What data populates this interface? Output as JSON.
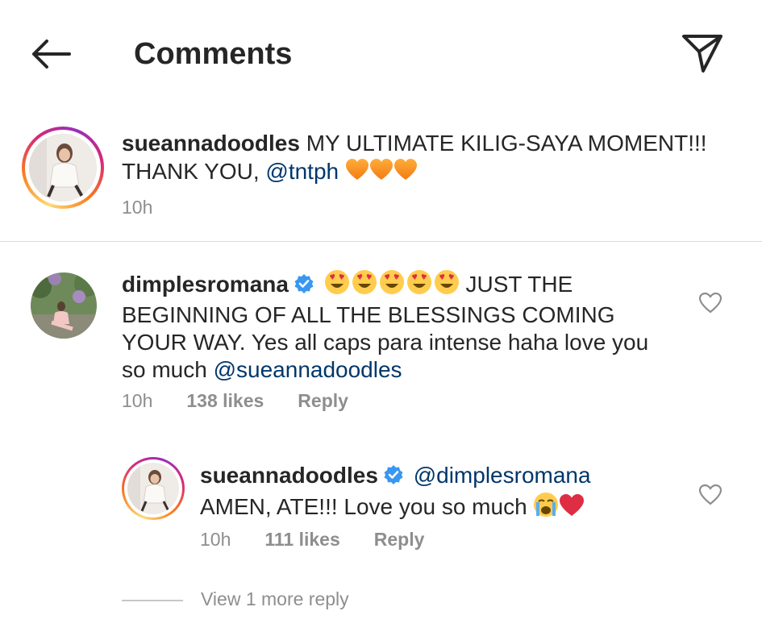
{
  "header": {
    "title": "Comments"
  },
  "caption": {
    "username": "sueannadoodles",
    "text": "MY ULTIMATE KILIG-SAYA MOMENT!!! THANK YOU, ",
    "mention": "@tntph",
    "emoji": "orange-heart-emoji x3",
    "time": "10h"
  },
  "comments": [
    {
      "username": "dimplesromana",
      "verified": true,
      "emoji": "heart-eyes-emoji x5",
      "text": " JUST THE BEGINNING OF ALL THE BLESSINGS COMING YOUR WAY. Yes all caps para intense haha love you so much ",
      "mention": "@sueannadoodles",
      "time": "10h",
      "likes": "138 likes",
      "reply_label": "Reply",
      "reply": {
        "username": "sueannadoodles",
        "verified": true,
        "mention": "@dimplesromana",
        "text": "AMEN, ATE!!! Love you so much ",
        "emoji": "crying-face-emoji, red-heart-emoji",
        "time": "10h",
        "likes": "111 likes",
        "reply_label": "Reply"
      }
    }
  ],
  "view_more": "View 1 more reply",
  "colors": {
    "text": "#262626",
    "secondary": "#8e8e8e",
    "mention": "#00376b",
    "verified": "#3897f0",
    "divider": "#dbdbdb"
  }
}
